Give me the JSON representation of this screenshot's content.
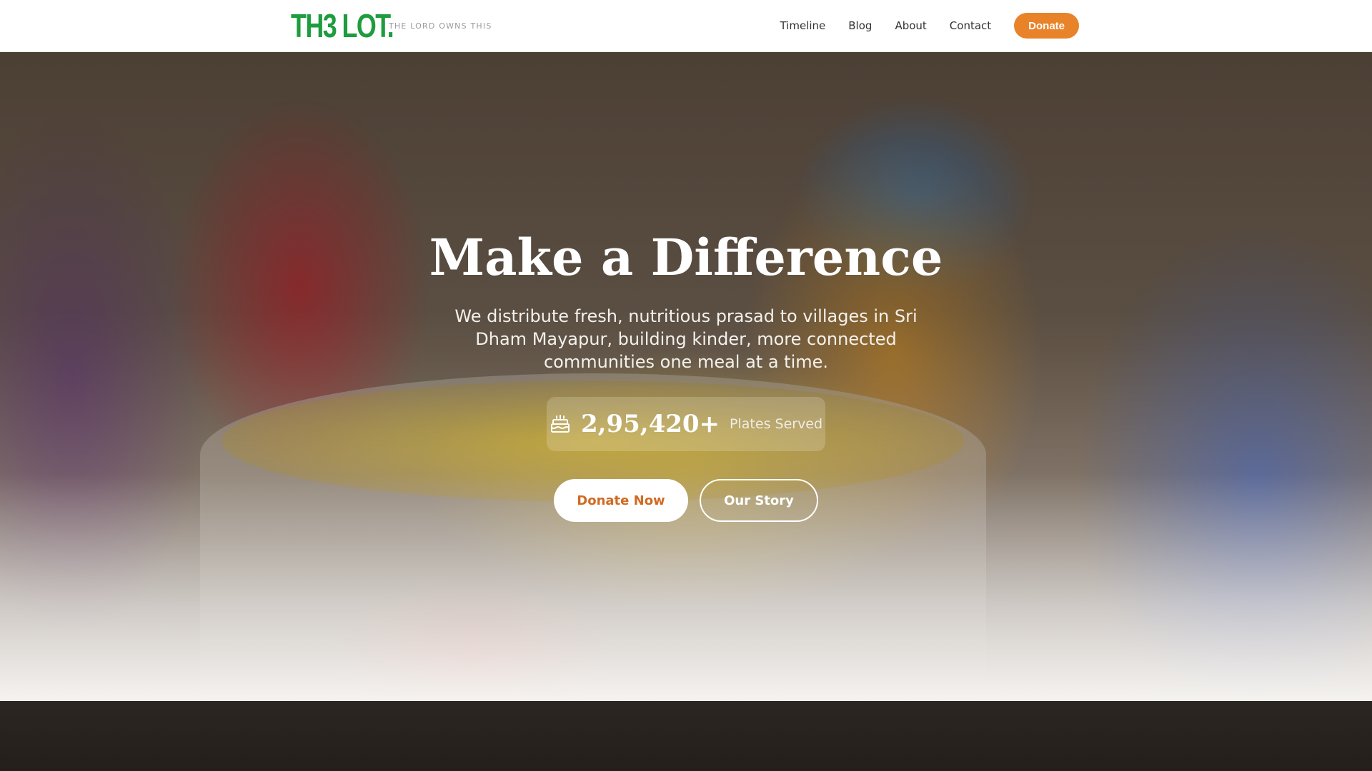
{
  "header": {
    "logo": "TH3 LOT.",
    "tagline": "THE LORD OWNS THIS",
    "nav": [
      {
        "label": "Timeline"
      },
      {
        "label": "Blog"
      },
      {
        "label": "About"
      },
      {
        "label": "Contact"
      }
    ],
    "donate_label": "Donate"
  },
  "hero": {
    "title": "Make a Difference",
    "subtitle": "We distribute fresh, nutritious prasad to villages in Sri Dham Mayapur, building kinder, more connected communities one meal at a time.",
    "stat": {
      "icon": "cake-icon",
      "value": "2,95,420+",
      "label": "Plates Served"
    },
    "primary_button": "Donate Now",
    "secondary_button": "Our Story"
  },
  "colors": {
    "brand_green": "#1e9c3e",
    "accent_orange": "#e8832a",
    "dark_section": "#2a2420"
  }
}
